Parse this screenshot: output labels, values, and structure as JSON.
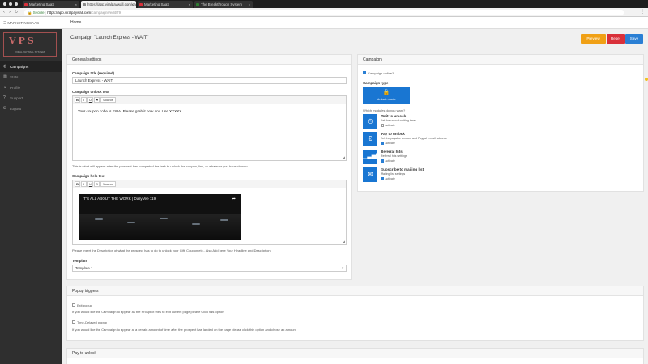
{
  "browser": {
    "tabs": [
      {
        "title": "Marketing SaaS",
        "active": false,
        "favicon_color": "#d9303a"
      },
      {
        "title": "https://app.viralpaywall.com/ca",
        "active": true,
        "favicon_color": "#888888"
      },
      {
        "title": "Marketing SaaS",
        "active": false,
        "favicon_color": "#d9303a"
      },
      {
        "title": "The Breakthrough System",
        "active": false,
        "favicon_color": "#2e7d32"
      }
    ],
    "url": {
      "secure_label": "Secure",
      "host": "https://app.viralpaywall.com",
      "path": "/campaigns/edit/79"
    }
  },
  "appbar": {
    "brand_text": "MARKETINGSAAS",
    "home_link": "Home"
  },
  "sidebar": {
    "logo_letters": "VPS",
    "logo_tagline": "VIRAL PAYWALL SYSTEM",
    "items": [
      {
        "label": "Campaigns",
        "icon": "globe-icon",
        "active": true
      },
      {
        "label": "Stats",
        "icon": "chart-icon",
        "active": false
      },
      {
        "label": "Profile",
        "icon": "user-icon",
        "active": false
      },
      {
        "label": "Support",
        "icon": "help-icon",
        "active": false
      },
      {
        "label": "Logout",
        "icon": "logout-icon",
        "active": false
      }
    ]
  },
  "header": {
    "title": "Campaign \"Launch Express - WAIT\"",
    "preview_label": "Preview",
    "reset_label": "Reset",
    "save_label": "Save"
  },
  "general": {
    "heading": "General settings",
    "title_label": "Campaign title (required)",
    "title_value": "Launch Express - WAIT",
    "unlock_label": "Campaign unlock text",
    "unlock_body": "Your coupon code is EWAI Please grab it now and Use XXXXX",
    "unlock_help": "This is what will appear after the prospect has completed the task to unlock the coupon, link, or whatever you have chosen",
    "help_label": "Campaign help text",
    "video_title": "IT'S ALL ABOUT THE WORK | DailyVee 119",
    "help_help": "Please insert the Description of what the prospect has to do to unlock your Gift, Coupon etc.. Also Add here Your Headline and Description",
    "template_label": "Template",
    "template_value": "Template 1",
    "toolbar": {
      "bold": "B",
      "italic": "I",
      "underline": "U",
      "strike": "S",
      "source": "Source"
    }
  },
  "campaign": {
    "heading": "Campaign",
    "online_label": "Campaign online?",
    "online_checked": true,
    "type_label": "Campaign type",
    "unlock_mode_label": "Unlock mode",
    "modules_question": "Which modules do you want?",
    "modules": [
      {
        "title": "Wait to unlock",
        "sub": "Set the unlock waiting time",
        "activate": "activate",
        "checked": false,
        "icon": "clock-icon"
      },
      {
        "title": "Pay to unlock",
        "sub": "Set the payable amount and Paypal e-mail address",
        "activate": "activate",
        "checked": true,
        "icon": "euro-icon"
      },
      {
        "title": "Referral hits",
        "sub": "Referral hits settings",
        "activate": "activate",
        "checked": true,
        "icon": "bar-chart-icon"
      },
      {
        "title": "Subscribe to mailing list",
        "sub": "Mailing list settings",
        "activate": "activate",
        "checked": true,
        "icon": "envelope-icon"
      }
    ]
  },
  "popup": {
    "heading": "Popup triggers",
    "exit_label": "Exit popup",
    "exit_help": "If you would like the Campaign to appear as the Prospect tries to exit current page please Click this option",
    "delayed_label": "Time-Delayed popup",
    "delayed_help": "If you would like the Campaign to appear at a certain amount of time after the prospect has landed on the page please click this option and chose an amount"
  },
  "pay": {
    "heading": "Pay to unlock"
  },
  "colors": {
    "accent": "#1976d2",
    "preview": "#f0a015",
    "reset": "#d9303a",
    "save": "#2a7fd4",
    "sidebar": "#2f2f2f"
  }
}
